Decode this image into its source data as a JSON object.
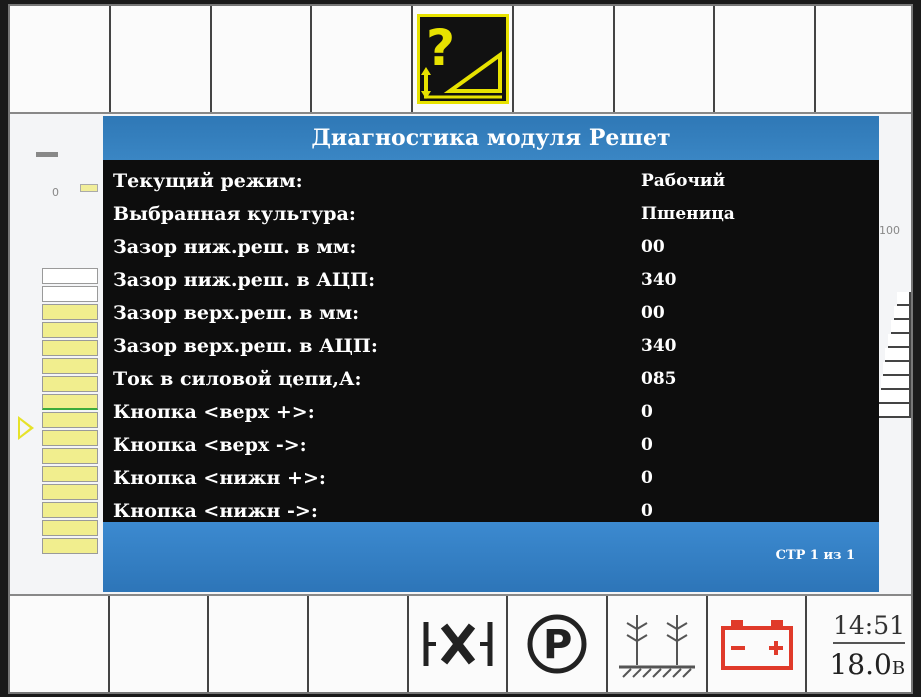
{
  "dialog": {
    "title": "Диагностика модуля Решет",
    "rows": [
      {
        "label": "Текущий режим:",
        "value": "Рабочий"
      },
      {
        "label": "Выбранная культура:",
        "value": "Пшеница"
      },
      {
        "label": "Зазор ниж.реш. в мм:",
        "value": "00"
      },
      {
        "label": "Зазор ниж.реш. в АЦП:",
        "value": "340"
      },
      {
        "label": "Зазор верх.реш. в мм:",
        "value": "00"
      },
      {
        "label": "Зазор верх.реш. в АЦП:",
        "value": "340"
      },
      {
        "label": "Ток в силовой цепи,А:",
        "value": "085"
      },
      {
        "label": "Кнопка <верх +>:",
        "value": "0"
      },
      {
        "label": "Кнопка <верх ->:",
        "value": "0"
      },
      {
        "label": "Кнопка <нижн +>:",
        "value": "0"
      },
      {
        "label": "Кнопка <нижн ->:",
        "value": "0"
      }
    ],
    "page_indicator": "СТР 1 из 1"
  },
  "left_gauge": {
    "min_label": "0"
  },
  "right_gauge": {
    "max_label": "100"
  },
  "top_bar": {
    "active_icon": "sieve-help-icon"
  },
  "bottom_bar": {
    "icons": [
      "sieve-gap-icon",
      "parking-icon",
      "crop-field-icon",
      "battery-icon"
    ],
    "time": "14:51",
    "voltage": "18.0",
    "voltage_unit": "В"
  },
  "colors": {
    "dialog_header": "#3a86c4",
    "accent_yellow": "#e7e200",
    "battery_red": "#e03a2a"
  }
}
